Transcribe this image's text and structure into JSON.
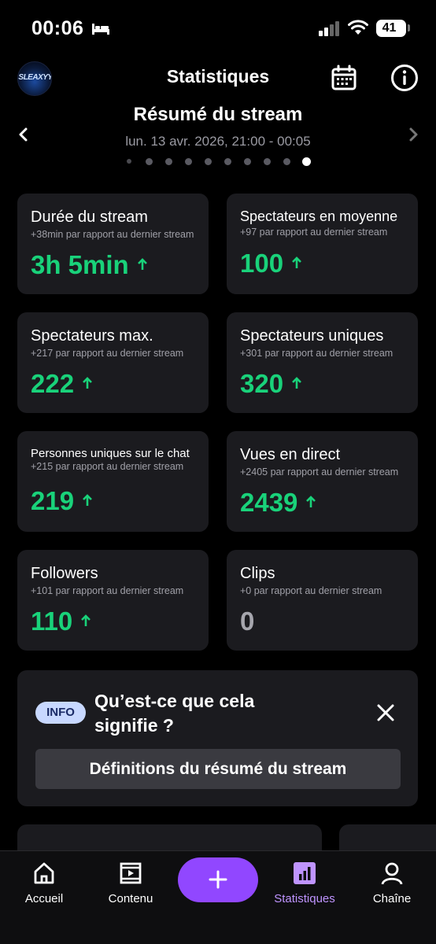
{
  "status_bar": {
    "time": "00:06",
    "battery": "41"
  },
  "header": {
    "avatar_text": "SLEAXYY",
    "title": "Statistiques",
    "icons": [
      "calendar-icon",
      "info-circle-icon"
    ]
  },
  "summary": {
    "title": "Résumé du stream",
    "date_range": "lun. 13 avr. 2026, 21:00 - 00:05",
    "page_count": 10,
    "active_page": 10
  },
  "stats": [
    {
      "label": "Durée du stream",
      "sub": "+38min par rapport au dernier stream",
      "value": "3h 5min",
      "trend": "up"
    },
    {
      "label": "Spectateurs en moyenne",
      "sub": "+97 par rapport au dernier stream",
      "value": "100",
      "trend": "up"
    },
    {
      "label": "Spectateurs max.",
      "sub": "+217 par rapport au dernier stream",
      "value": "222",
      "trend": "up"
    },
    {
      "label": "Spectateurs uniques",
      "sub": "+301 par rapport au dernier stream",
      "value": "320",
      "trend": "up"
    },
    {
      "label": "Personnes uniques sur le chat",
      "sub": "+215 par rapport au dernier stream",
      "value": "219",
      "trend": "up"
    },
    {
      "label": "Vues en direct",
      "sub": "+2405 par rapport au dernier stream",
      "value": "2439",
      "trend": "up"
    },
    {
      "label": "Followers",
      "sub": "+101 par rapport au dernier stream",
      "value": "110",
      "trend": "up"
    },
    {
      "label": "Clips",
      "sub": "+0 par rapport au dernier stream",
      "value": "0",
      "trend": "none"
    }
  ],
  "info_panel": {
    "badge": "INFO",
    "question": "Qu’est-ce que cela signifie ?",
    "button": "Définitions du résumé du stream"
  },
  "bottom_nav": {
    "items": [
      {
        "label": "Accueil",
        "icon": "home-icon"
      },
      {
        "label": "Contenu",
        "icon": "film-icon"
      },
      {
        "label": "Statistiques",
        "icon": "bar-chart-icon",
        "active": true
      },
      {
        "label": "Chaîne",
        "icon": "profile-icon"
      }
    ],
    "create_icon": "plus-icon"
  },
  "colors": {
    "accent": "#9147ff",
    "positive": "#19d27a",
    "card_bg": "#1b1b1f",
    "active_nav": "#bf94ff"
  }
}
